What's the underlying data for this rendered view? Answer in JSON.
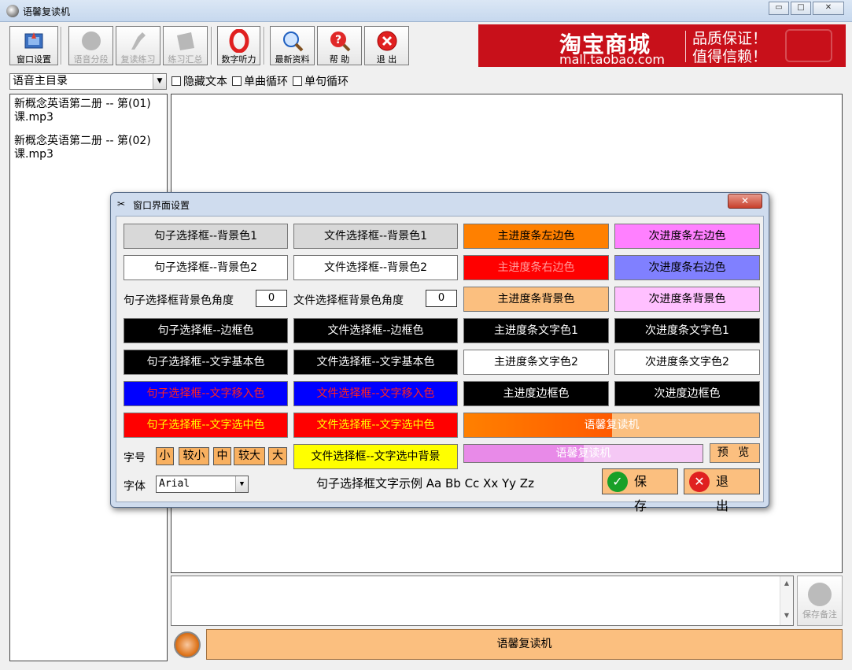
{
  "window": {
    "title": "语馨复读机",
    "minimize": "▭",
    "maximize": "□",
    "close": "✕"
  },
  "toolbar": {
    "buttons": [
      {
        "label": "窗口设置",
        "icon": "window-settings-icon",
        "enabled": true
      },
      {
        "label": "语音分段",
        "icon": "voice-segment-icon",
        "enabled": false
      },
      {
        "label": "复读练习",
        "icon": "repeat-practice-icon",
        "enabled": false
      },
      {
        "label": "练习汇总",
        "icon": "practice-summary-icon",
        "enabled": false
      },
      {
        "label": "数字听力",
        "icon": "number-listening-icon",
        "enabled": true
      },
      {
        "label": "最新资料",
        "icon": "latest-material-icon",
        "enabled": true
      },
      {
        "label": "帮 助",
        "icon": "help-icon",
        "enabled": true
      },
      {
        "label": "退 出",
        "icon": "exit-icon",
        "enabled": true
      }
    ]
  },
  "banner": {
    "brand": "淘宝商城",
    "url": "mall.taobao.com",
    "line1": "品质保证！",
    "line2": "值得信赖！"
  },
  "controls": {
    "directory": "语音主目录",
    "hide_text": "隐藏文本",
    "loop_track": "单曲循环",
    "loop_sentence": "单句循环"
  },
  "files": [
    "新概念英语第二册 -- 第(01)课.mp3",
    "新概念英语第二册 -- 第(02)课.mp3"
  ],
  "bottom": {
    "player_text": "语馨复读机",
    "save_note": "保存备注",
    "scroll_up": "▲",
    "scroll_down": "▼"
  },
  "dialog": {
    "title": "窗口界面设置",
    "close": "✕",
    "col1": {
      "bg1": "句子选择框--背景色1",
      "bg2": "句子选择框--背景色2",
      "angle_label": "句子选择框背景色角度",
      "angle_value": "0",
      "border": "句子选择框--边框色",
      "text_base": "句子选择框--文字基本色",
      "text_hover": "句子选择框--文字移入色",
      "text_selected": "句子选择框--文字选中色"
    },
    "col2": {
      "bg1": "文件选择框--背景色1",
      "bg2": "文件选择框--背景色2",
      "angle_label": "文件选择框背景色角度",
      "angle_value": "0",
      "border": "文件选择框--边框色",
      "text_base": "文件选择框--文字基本色",
      "text_hover": "文件选择框--文字移入色",
      "text_selected": "文件选择框--文字选中色",
      "selected_bg": "文件选择框--文字选中背景"
    },
    "col3": {
      "left": "主进度条左边色",
      "right": "主进度条右边色",
      "bg": "主进度条背景色",
      "text1": "主进度条文字色1",
      "text2": "主进度条文字色2",
      "border": "主进度边框色"
    },
    "col4": {
      "left": "次进度条左边色",
      "right": "次进度条右边色",
      "bg": "次进度条背景色",
      "text1": "次进度条文字色1",
      "text2": "次进度条文字色2",
      "border": "次进度边框色"
    },
    "main_progress": {
      "text": "语馨复读机",
      "level": 0.5
    },
    "sub_progress": {
      "text": "语馨复读机",
      "level": 0.5
    },
    "preview": "预 览",
    "size_label": "字号",
    "sizes": [
      "小",
      "较小",
      "中",
      "较大",
      "大"
    ],
    "font_label": "字体",
    "font_value": "Arial",
    "sample": "句子选择框文字示例 Aa Bb Cc Xx Yy Zz",
    "save": "保 存",
    "exit": "退 出"
  },
  "colors": {
    "orange": "#ff8000",
    "red": "#ff0000",
    "blue": "#0000ff",
    "violet": "#ff80ff",
    "periwinkle": "#8080ff",
    "light_orange": "#fbbf7f",
    "light_pink": "#ffc0ff",
    "yellow": "#ffff00",
    "banner_red": "#c8101a"
  }
}
